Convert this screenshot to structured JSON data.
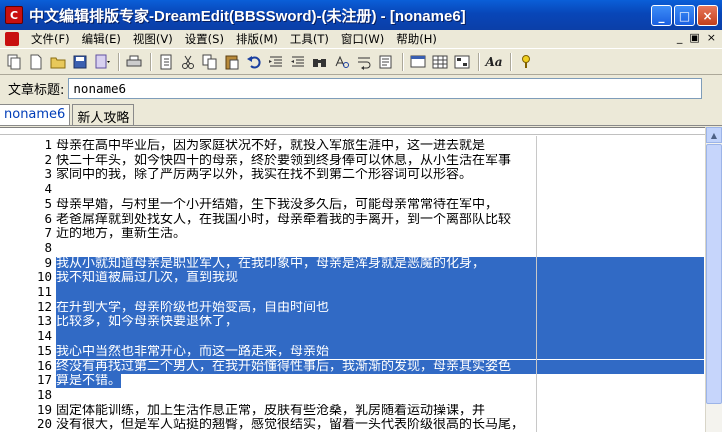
{
  "window": {
    "title": "中文编辑排版专家-DreamEdit(BBSSword)-(未注册) - [noname6]",
    "minimize": "_",
    "maximize": "□",
    "close": "×"
  },
  "menu": {
    "items": [
      "文件(F)",
      "编辑(E)",
      "视图(V)",
      "设置(S)",
      "排版(M)",
      "工具(T)",
      "窗口(W)",
      "帮助(H)"
    ],
    "mdi_min": "_",
    "mdi_restore": "▣",
    "mdi_close": "×"
  },
  "toolbar": {
    "icons": [
      "copy-doc-icon",
      "new-doc-icon",
      "open-folder-icon",
      "save-disk-icon",
      "new-dropdown-icon",
      "print-icon",
      "page-icon",
      "cut-icon",
      "copy-icon",
      "paste-icon",
      "undo-icon",
      "indent-icon",
      "outdent-icon",
      "find-icon",
      "replace-icon",
      "wrap-icon",
      "format-icon",
      "template-icon",
      "table-icon",
      "grid-icon",
      "font-icon",
      "help-icon"
    ]
  },
  "title_field": {
    "label": "文章标题:",
    "value": "noname6"
  },
  "tabs": [
    {
      "label": "noname6",
      "active": true
    },
    {
      "label": "新人攻略",
      "active": false
    }
  ],
  "editor": {
    "lines": [
      {
        "n": "1",
        "text": "    母亲在高中毕业后，因为家庭状况不好，就投入军旅生涯中，这一进去就是",
        "sel": "none"
      },
      {
        "n": "2",
        "text": "快二十年头，如今快四十的母亲，终於要领到终身俸可以休息，从小生活在军事",
        "sel": "none"
      },
      {
        "n": "3",
        "text": "家同中的我，除了严厉两字以外，我实在找不到第二个形容词可以形容。",
        "sel": "none"
      },
      {
        "n": "4",
        "text": "",
        "sel": "none"
      },
      {
        "n": "5",
        "text": "    母亲早婚，与村里一个小开结婚，生下我没多久后，可能母亲常常待在军中，",
        "sel": "none"
      },
      {
        "n": "6",
        "text": "老爸屌痒就到处找女人，在我国小时，母亲牵着我的手离开，到一个离部队比较",
        "sel": "none"
      },
      {
        "n": "7",
        "text": "近的地方，重新生活。",
        "sel": "none"
      },
      {
        "n": "8",
        "text": "",
        "sel": "none"
      },
      {
        "n": "9",
        "text": "    我从小就知道母亲是职业军人，在我印象中，母亲是浑身就是恶魔的化身，",
        "sel": "full"
      },
      {
        "n": "10",
        "text": "我不知道被扁过几次，直到我现",
        "sel": "full"
      },
      {
        "n": "11",
        "text": "",
        "sel": "full"
      },
      {
        "n": "12",
        "text": "在升到大学，母亲阶级也开始变高，自由时间也",
        "sel": "full"
      },
      {
        "n": "13",
        "text": "比较多，如今母亲快要退休了，",
        "sel": "full"
      },
      {
        "n": "14",
        "text": "",
        "sel": "full"
      },
      {
        "n": "15",
        "text": "我心中当然也非常开心，而这一路走来，母亲始",
        "sel": "full"
      },
      {
        "n": "16",
        "text": "终没有再找过第二个男人，在我开始懂得性事后，我渐渐的发现，母亲其实姿色",
        "sel": "full"
      },
      {
        "n": "17",
        "text": "算是不错。",
        "sel": "partial"
      },
      {
        "n": "18",
        "text": "",
        "sel": "none"
      },
      {
        "n": "19",
        "text": "    固定体能训练，加上生活作息正常，皮肤有些沧桑，乳房随着运动操课，并",
        "sel": "none"
      },
      {
        "n": "20",
        "text": "没有很大，但是军人站挺的翘臀，感觉很结实，留着一头代表阶级很高的长马尾，",
        "sel": "none"
      }
    ]
  }
}
